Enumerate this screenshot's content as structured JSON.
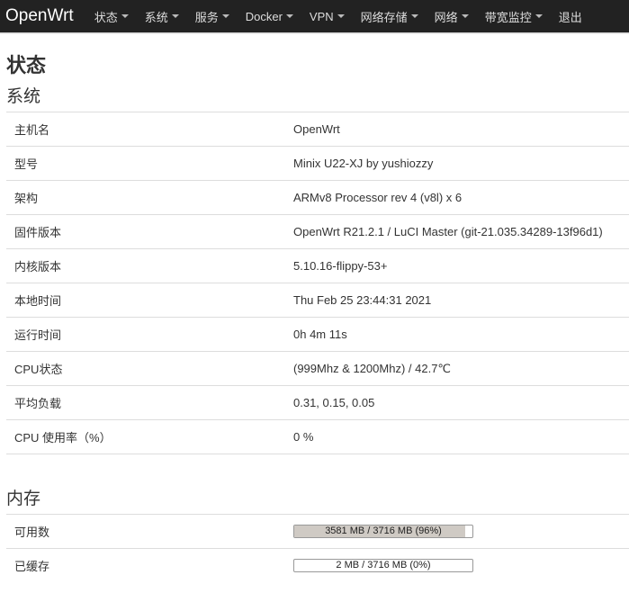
{
  "brand": "OpenWrt",
  "nav": [
    {
      "label": "状态",
      "dropdown": true
    },
    {
      "label": "系统",
      "dropdown": true
    },
    {
      "label": "服务",
      "dropdown": true
    },
    {
      "label": "Docker",
      "dropdown": true
    },
    {
      "label": "VPN",
      "dropdown": true
    },
    {
      "label": "网络存储",
      "dropdown": true
    },
    {
      "label": "网络",
      "dropdown": true
    },
    {
      "label": "带宽监控",
      "dropdown": true
    },
    {
      "label": "退出",
      "dropdown": false
    }
  ],
  "page_title": "状态",
  "system": {
    "title": "系统",
    "rows": [
      {
        "label": "主机名",
        "value": "OpenWrt"
      },
      {
        "label": "型号",
        "value": "Minix U22-XJ by yushiozzy"
      },
      {
        "label": "架构",
        "value": "ARMv8 Processor rev 4 (v8l) x 6"
      },
      {
        "label": "固件版本",
        "value": "OpenWrt R21.2.1 / LuCI Master (git-21.035.34289-13f96d1)"
      },
      {
        "label": "内核版本",
        "value": "5.10.16-flippy-53+"
      },
      {
        "label": "本地时间",
        "value": "Thu Feb 25 23:44:31 2021"
      },
      {
        "label": "运行时间",
        "value": "0h 4m 11s"
      },
      {
        "label": "CPU状态",
        "value": "(999Mhz & 1200Mhz) / 42.7℃"
      },
      {
        "label": "平均负载",
        "value": "0.31, 0.15, 0.05"
      },
      {
        "label": "CPU 使用率（%）",
        "value": "0 %"
      }
    ]
  },
  "memory": {
    "title": "内存",
    "rows": [
      {
        "label": "可用数",
        "text": "3581 MB / 3716 MB (96%)",
        "percent": 96
      },
      {
        "label": "已缓存",
        "text": "2 MB / 3716 MB (0%)",
        "percent": 0
      }
    ]
  },
  "colors": {
    "navbar": "#222222",
    "progress_fill": "#cfcac4"
  }
}
